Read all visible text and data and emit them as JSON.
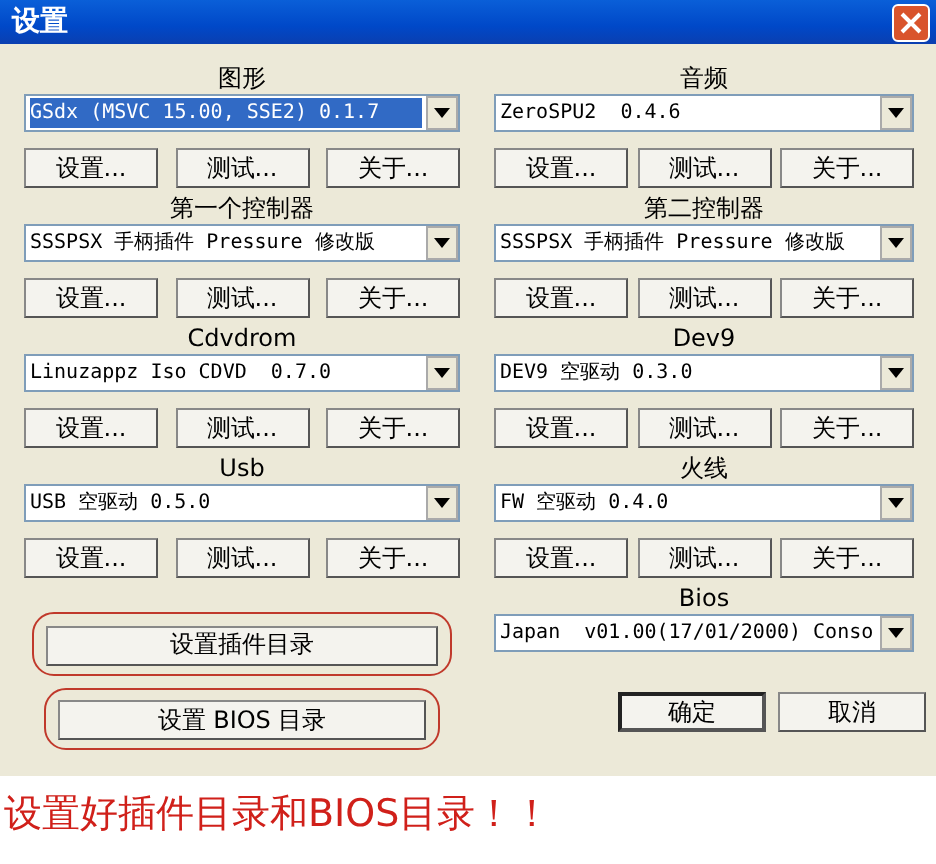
{
  "window": {
    "title": "设置"
  },
  "plugins": [
    {
      "label": "图形",
      "value": "GSdx (MSVC 15.00, SSE2) 0.1.7",
      "focused": true,
      "buttons": [
        "设置...",
        "测试...",
        "关于..."
      ]
    },
    {
      "label": "音频",
      "value": "ZeroSPU2  0.4.6",
      "focused": false,
      "buttons": [
        "设置...",
        "测试...",
        "关于..."
      ]
    },
    {
      "label": "第一个控制器",
      "value": "SSSPSX 手柄插件 Pressure 修改版",
      "focused": false,
      "buttons": [
        "设置...",
        "测试...",
        "关于..."
      ]
    },
    {
      "label": "第二控制器",
      "value": "SSSPSX 手柄插件 Pressure 修改版",
      "focused": false,
      "buttons": [
        "设置...",
        "测试...",
        "关于..."
      ]
    },
    {
      "label": "Cdvdrom",
      "value": "Linuzappz Iso CDVD  0.7.0",
      "focused": false,
      "buttons": [
        "设置...",
        "测试...",
        "关于..."
      ]
    },
    {
      "label": "Dev9",
      "value": "DEV9 空驱动 0.3.0",
      "focused": false,
      "buttons": [
        "设置...",
        "测试...",
        "关于..."
      ]
    },
    {
      "label": "Usb",
      "value": "USB 空驱动 0.5.0",
      "focused": false,
      "buttons": [
        "设置...",
        "测试...",
        "关于..."
      ]
    },
    {
      "label": "火线",
      "value": "FW 空驱动 0.4.0",
      "focused": false,
      "buttons": [
        "设置...",
        "测试...",
        "关于..."
      ]
    }
  ],
  "bios": {
    "label": "Bios",
    "value": "Japan  v01.00(17/01/2000) Conso"
  },
  "directory_buttons": [
    {
      "label": "设置插件目录",
      "annotated": true
    },
    {
      "label": "设置 BIOS 目录",
      "annotated": true
    }
  ],
  "dialog_buttons": [
    {
      "label": "确定",
      "default": true
    },
    {
      "label": "取消",
      "default": false
    }
  ],
  "caption": "设置好插件目录和BIOS目录！！"
}
